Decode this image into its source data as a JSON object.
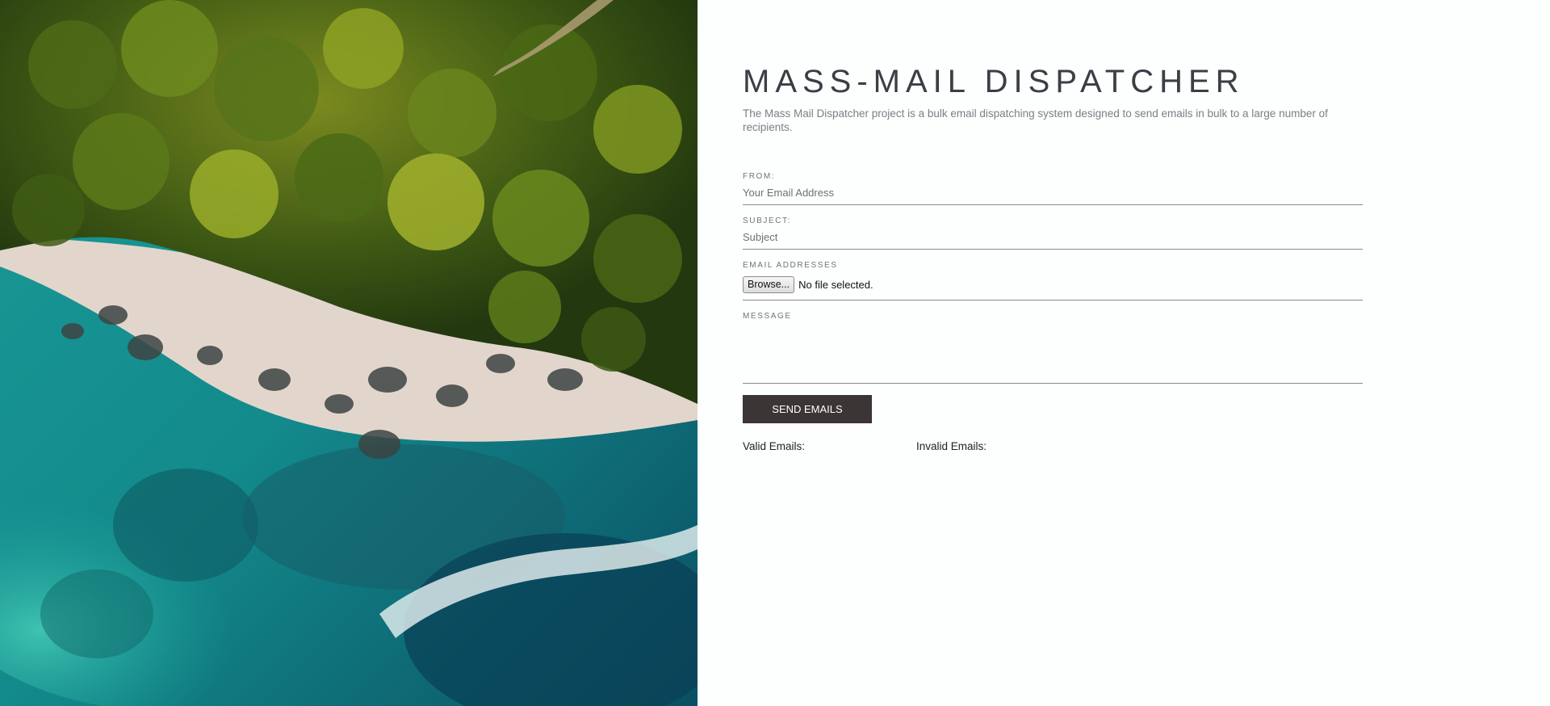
{
  "header": {
    "title": "MASS-MAIL DISPATCHER",
    "description": "The Mass Mail Dispatcher project is a bulk email dispatching system designed to send emails in bulk to a large number of recipients."
  },
  "form": {
    "from": {
      "label": "FROM:",
      "placeholder": "Your Email Address",
      "value": ""
    },
    "subject": {
      "label": "SUBJECT:",
      "placeholder": "Subject",
      "value": ""
    },
    "email_addresses": {
      "label": "EMAIL ADDRESSES",
      "browse_label": "Browse...",
      "file_status": "No file selected."
    },
    "message": {
      "label": "MESSAGE",
      "value": ""
    },
    "send_label": "SEND EMAILS"
  },
  "results": {
    "valid_label": "Valid Emails:",
    "invalid_label": "Invalid Emails:"
  },
  "colors": {
    "title": "#3a3f45",
    "button_bg": "#3b3536",
    "page_bg": "#fdfefe"
  }
}
